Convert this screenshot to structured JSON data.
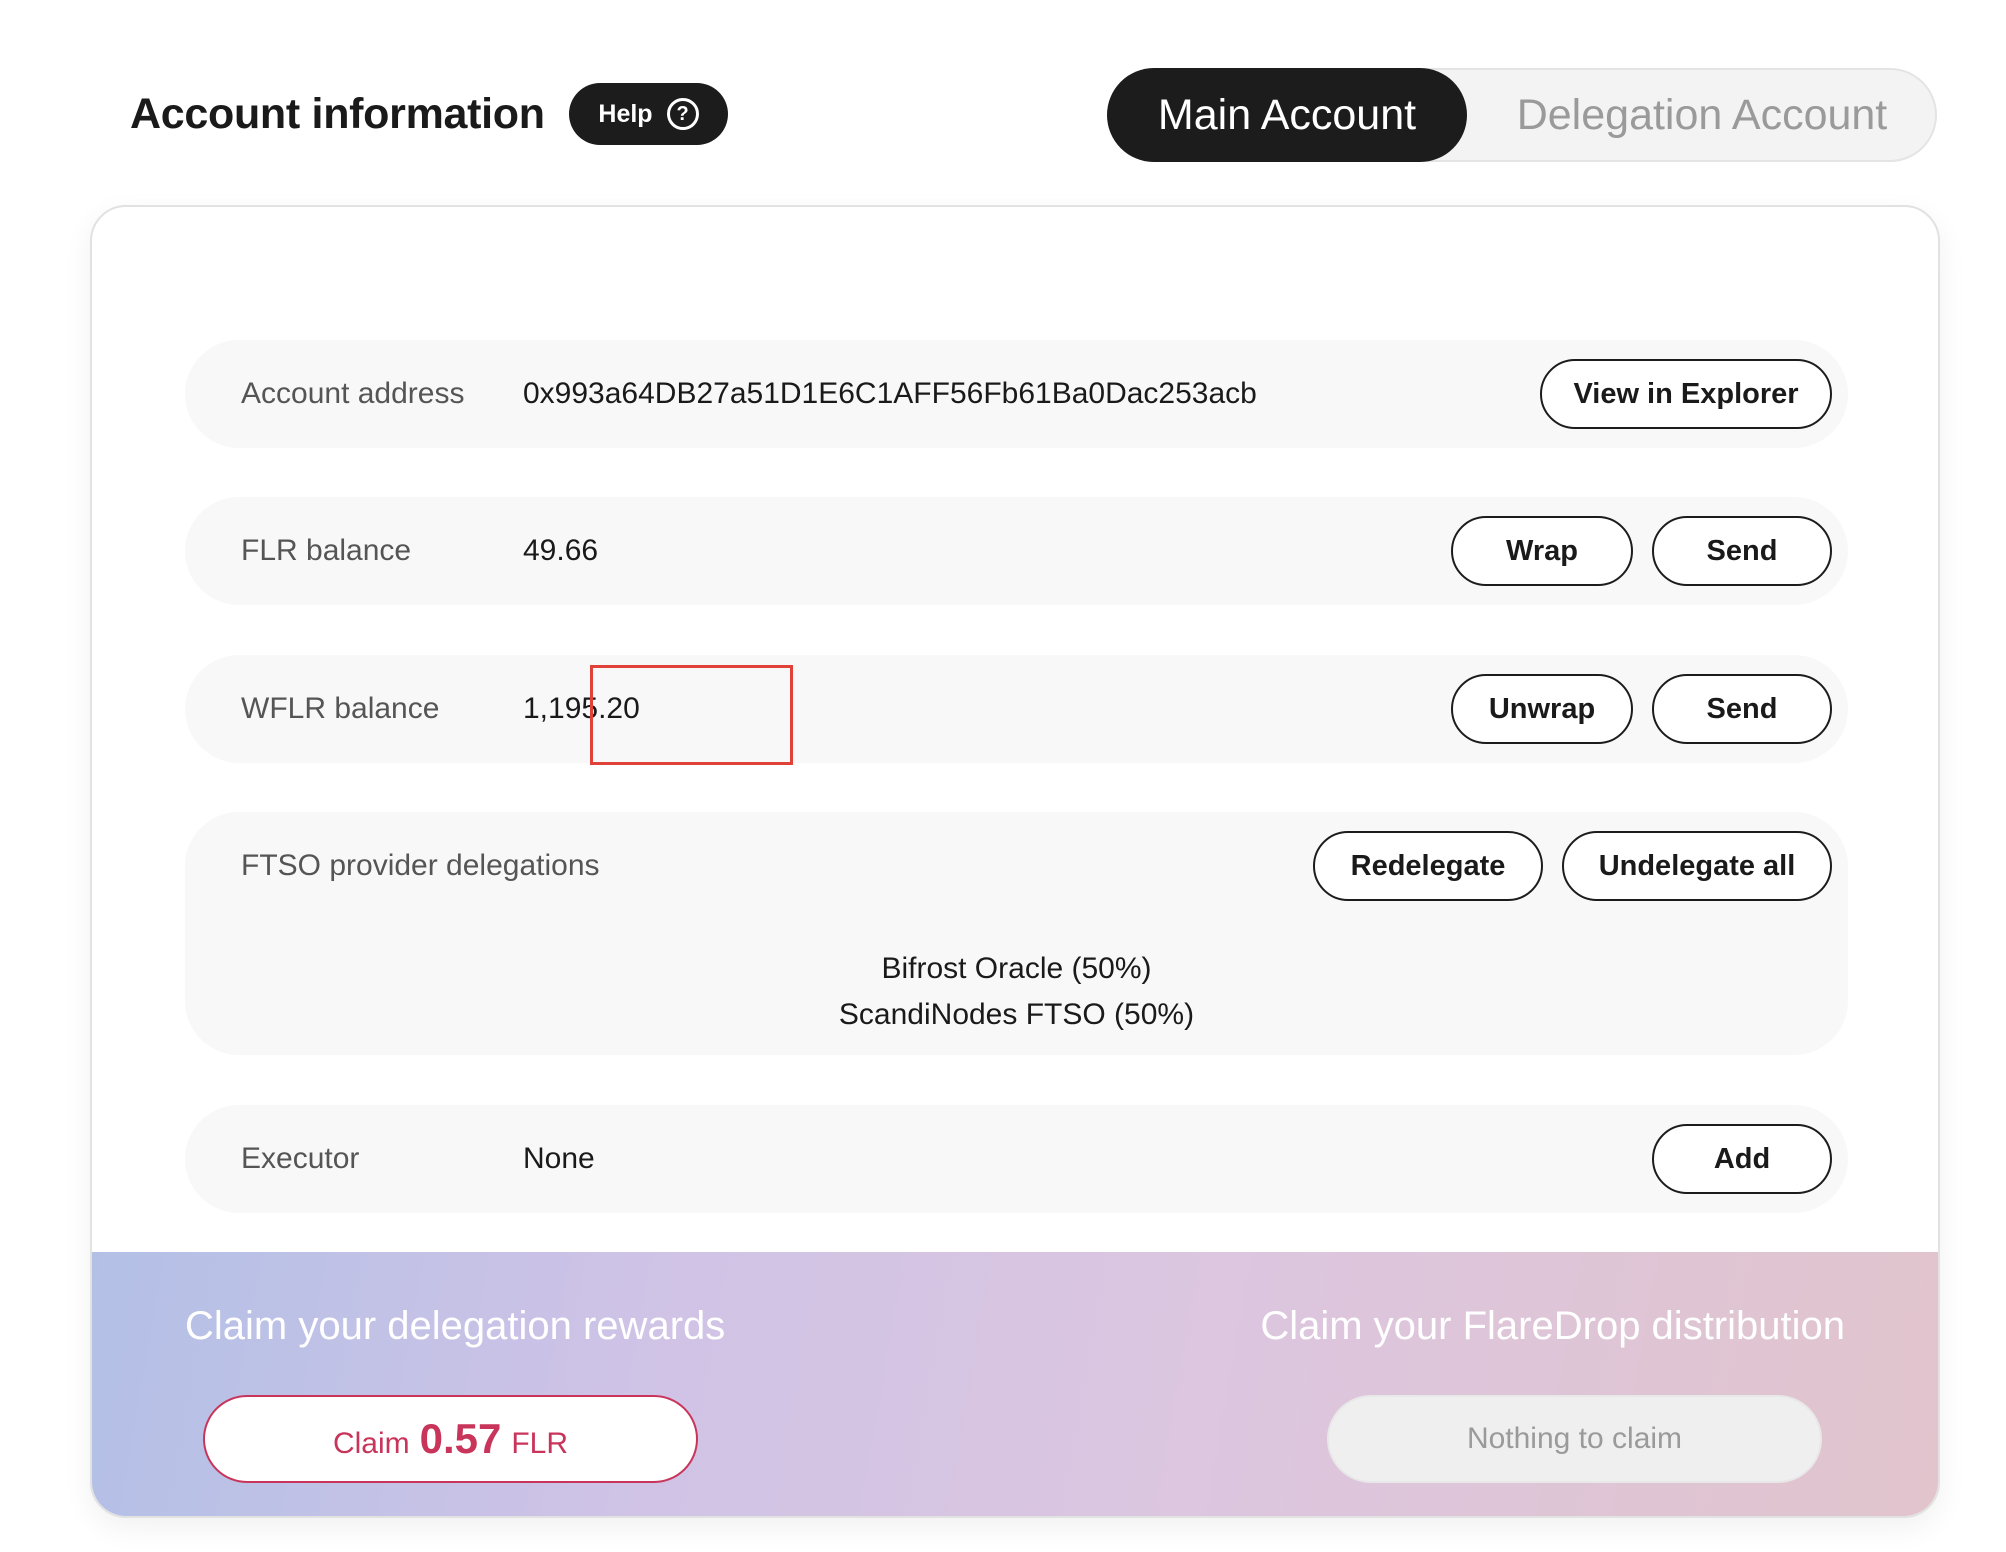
{
  "header": {
    "title": "Account information",
    "help_label": "Help",
    "help_icon": "question-circle-icon",
    "tabs": [
      {
        "label": "Main Account",
        "active": true
      },
      {
        "label": "Delegation Account",
        "active": false
      }
    ]
  },
  "account": {
    "address_label": "Account address",
    "address_value": "0x993a64DB27a51D1E6C1AFF56Fb61Ba0Dac253acb",
    "explorer_button": "View in Explorer",
    "flr_label": "FLR balance",
    "flr_value": "49.66",
    "wrap_button": "Wrap",
    "send_button": "Send",
    "wflr_label": "WFLR balance",
    "wflr_value": "1,195.20",
    "unwrap_button": "Unwrap",
    "wflr_send_button": "Send",
    "delegations_label": "FTSO provider delegations",
    "redelegate_button": "Redelegate",
    "undelegate_button": "Undelegate all",
    "delegations": [
      "Bifrost Oracle (50%)",
      "ScandiNodes FTSO (50%)"
    ],
    "executor_label": "Executor",
    "executor_value": "None",
    "add_button": "Add"
  },
  "claim": {
    "rewards_title": "Claim your delegation rewards",
    "claim_prefix": "Claim",
    "claim_amount": "0.57",
    "claim_unit": "FLR",
    "flaredrop_title": "Claim your FlareDrop distribution",
    "nothing_label": "Nothing to claim"
  },
  "colors": {
    "accent_dark": "#1c1c1c",
    "claim_accent": "#c8345a",
    "highlight": "#e0423a"
  }
}
